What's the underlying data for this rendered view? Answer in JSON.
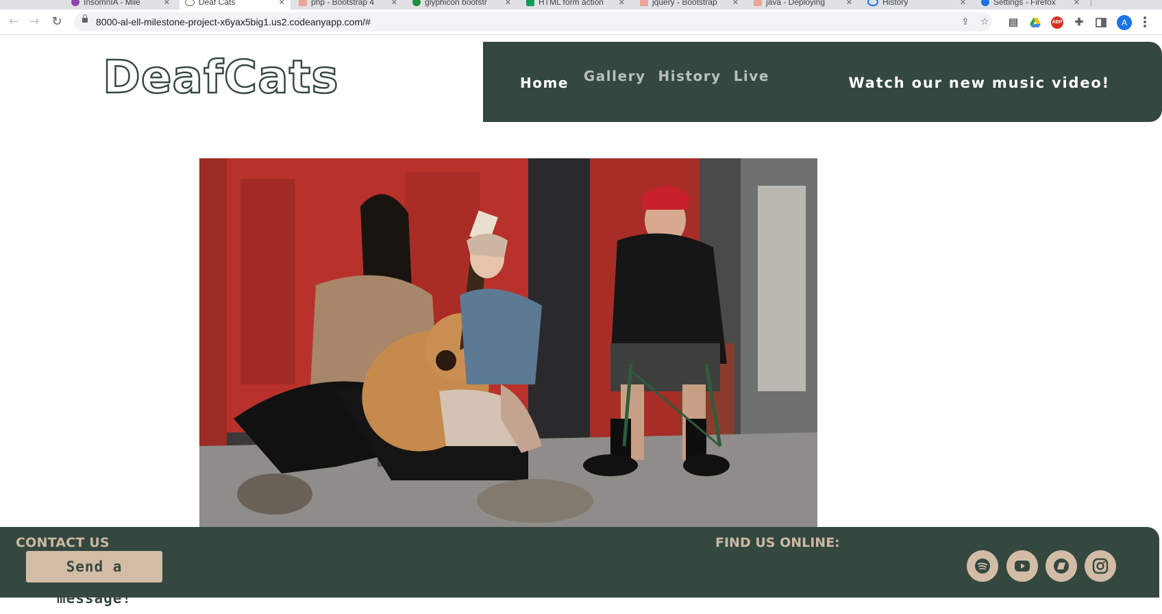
{
  "browser": {
    "tabs": [
      {
        "label": "InsomnIA - Mile",
        "favicon_color": "#8e44ad",
        "active": false
      },
      {
        "label": "Deaf Cats",
        "favicon_color": "#5f6368",
        "active": true
      },
      {
        "label": "php - Bootstrap 4",
        "favicon_color": "#e8a598",
        "active": false
      },
      {
        "label": "glyphicon bootstr",
        "favicon_color": "#1e8e3e",
        "active": false
      },
      {
        "label": "HTML form action",
        "favicon_color": "#0f9d58",
        "active": false
      },
      {
        "label": "jquery - Bootstrap",
        "favicon_color": "#e8a598",
        "active": false
      },
      {
        "label": "java - Deploying",
        "favicon_color": "#e8a598",
        "active": false
      },
      {
        "label": "History",
        "favicon_color": "#1a73e8",
        "active": false
      },
      {
        "label": "Settings - Firefox",
        "favicon_color": "#1a73e8",
        "active": false
      }
    ],
    "url": "8000-al-ell-milestone-project-x6yax5big1.us2.codeanyapp.com/#",
    "profile_initial": "A",
    "extensions": [
      {
        "name": "reader-icon",
        "label": "",
        "color": "#5f6368"
      },
      {
        "name": "google-drive-icon",
        "label": "",
        "color": "#34a853"
      },
      {
        "name": "adblock-plus-icon",
        "label": "ABP",
        "color": "#d93025"
      },
      {
        "name": "puzzle-icon",
        "label": "",
        "color": "#5f6368"
      },
      {
        "name": "sidebar-icon",
        "label": "",
        "color": "#5f6368"
      }
    ]
  },
  "site": {
    "logo_text": "DeafCats",
    "nav": [
      {
        "label": "Home",
        "active": true
      },
      {
        "label": "Gallery",
        "active": false
      },
      {
        "label": "History",
        "active": false
      },
      {
        "label": "Live",
        "active": false
      }
    ],
    "video_link": "Watch our new music video!",
    "footer": {
      "contact_title": "CONTACT US",
      "message_button": "Send a message!",
      "findus_title": "FIND US ONLINE:",
      "socials": [
        {
          "name": "spotify-icon"
        },
        {
          "name": "youtube-icon"
        },
        {
          "name": "bandcamp-icon"
        },
        {
          "name": "instagram-icon"
        }
      ]
    },
    "colors": {
      "brand_green": "#34483f",
      "sand": "#d2bca6",
      "footer_text": "#cbb9a3"
    }
  }
}
